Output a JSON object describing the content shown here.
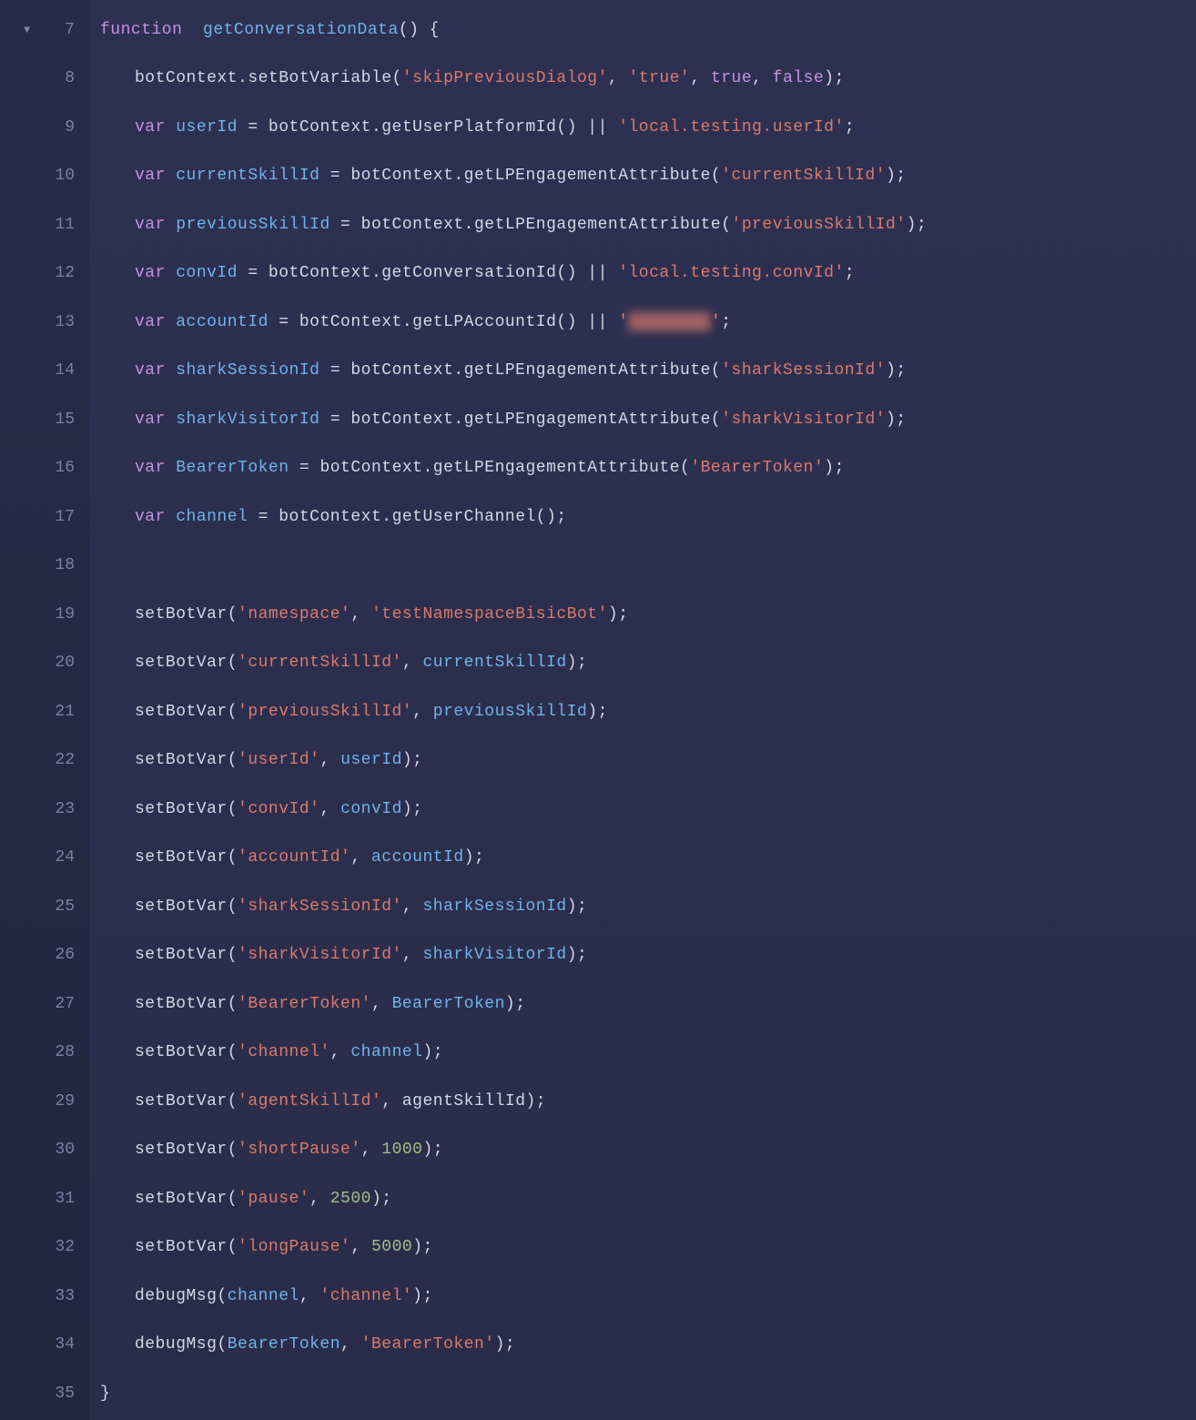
{
  "gutter": {
    "start": 7,
    "end": 35,
    "foldRow": 7
  },
  "code": {
    "lines": [
      {
        "n": 7,
        "indent": "ind1",
        "tokens": [
          [
            "kw",
            "function"
          ],
          [
            "def",
            "  "
          ],
          [
            "fn",
            "getConversationData"
          ],
          [
            "def",
            "() {"
          ]
        ]
      },
      {
        "n": 8,
        "indent": "ind2",
        "tokens": [
          [
            "def",
            "botContext.setBotVariable("
          ],
          [
            "str",
            "'skipPreviousDialog'"
          ],
          [
            "def",
            ", "
          ],
          [
            "str",
            "'true'"
          ],
          [
            "def",
            ", "
          ],
          [
            "kw",
            "true"
          ],
          [
            "def",
            ", "
          ],
          [
            "kw",
            "false"
          ],
          [
            "def",
            ");"
          ]
        ]
      },
      {
        "n": 9,
        "indent": "ind2",
        "tokens": [
          [
            "kw",
            "var"
          ],
          [
            "def",
            " "
          ],
          [
            "id",
            "userId"
          ],
          [
            "def",
            " = botContext.getUserPlatformId() || "
          ],
          [
            "str",
            "'local.testing.userId'"
          ],
          [
            "def",
            ";"
          ]
        ]
      },
      {
        "n": 10,
        "indent": "ind2",
        "tokens": [
          [
            "kw",
            "var"
          ],
          [
            "def",
            " "
          ],
          [
            "id",
            "currentSkillId"
          ],
          [
            "def",
            " = botContext.getLPEngagementAttribute("
          ],
          [
            "str",
            "'currentSkillId'"
          ],
          [
            "def",
            ");"
          ]
        ]
      },
      {
        "n": 11,
        "indent": "ind2",
        "tokens": [
          [
            "kw",
            "var"
          ],
          [
            "def",
            " "
          ],
          [
            "id",
            "previousSkillId"
          ],
          [
            "def",
            " = botContext.getLPEngagementAttribute("
          ],
          [
            "str",
            "'previousSkillId'"
          ],
          [
            "def",
            ");"
          ]
        ]
      },
      {
        "n": 12,
        "indent": "ind2",
        "tokens": [
          [
            "kw",
            "var"
          ],
          [
            "def",
            " "
          ],
          [
            "id",
            "convId"
          ],
          [
            "def",
            " = botContext.getConversationId() || "
          ],
          [
            "str",
            "'local.testing.convId'"
          ],
          [
            "def",
            ";"
          ]
        ]
      },
      {
        "n": 13,
        "indent": "ind2",
        "tokens": [
          [
            "kw",
            "var"
          ],
          [
            "def",
            " "
          ],
          [
            "id",
            "accountId"
          ],
          [
            "def",
            " = botContext.getLPAccountId() || "
          ],
          [
            "str",
            "'"
          ],
          [
            "redact",
            "████████"
          ],
          [
            "str",
            "'"
          ],
          [
            "def",
            ";"
          ]
        ]
      },
      {
        "n": 14,
        "indent": "ind2",
        "tokens": [
          [
            "kw",
            "var"
          ],
          [
            "def",
            " "
          ],
          [
            "id",
            "sharkSessionId"
          ],
          [
            "def",
            " = botContext.getLPEngagementAttribute("
          ],
          [
            "str",
            "'sharkSessionId'"
          ],
          [
            "def",
            ");"
          ]
        ]
      },
      {
        "n": 15,
        "indent": "ind2",
        "tokens": [
          [
            "kw",
            "var"
          ],
          [
            "def",
            " "
          ],
          [
            "id",
            "sharkVisitorId"
          ],
          [
            "def",
            " = botContext.getLPEngagementAttribute("
          ],
          [
            "str",
            "'sharkVisitorId'"
          ],
          [
            "def",
            ");"
          ]
        ]
      },
      {
        "n": 16,
        "indent": "ind2",
        "tokens": [
          [
            "kw",
            "var"
          ],
          [
            "def",
            " "
          ],
          [
            "id",
            "BearerToken"
          ],
          [
            "def",
            " = botContext.getLPEngagementAttribute("
          ],
          [
            "str",
            "'BearerToken'"
          ],
          [
            "def",
            ");"
          ]
        ]
      },
      {
        "n": 17,
        "indent": "ind2",
        "tokens": [
          [
            "kw",
            "var"
          ],
          [
            "def",
            " "
          ],
          [
            "id",
            "channel"
          ],
          [
            "def",
            " = botContext.getUserChannel();"
          ]
        ]
      },
      {
        "n": 18,
        "indent": "ind2",
        "tokens": [
          [
            "def",
            ""
          ]
        ]
      },
      {
        "n": 19,
        "indent": "ind2",
        "tokens": [
          [
            "def",
            "setBotVar("
          ],
          [
            "str",
            "'namespace'"
          ],
          [
            "def",
            ", "
          ],
          [
            "str",
            "'testNamespaceBisicBot'"
          ],
          [
            "def",
            ");"
          ]
        ]
      },
      {
        "n": 20,
        "indent": "ind2",
        "tokens": [
          [
            "def",
            "setBotVar("
          ],
          [
            "str",
            "'currentSkillId'"
          ],
          [
            "def",
            ", "
          ],
          [
            "id",
            "currentSkillId"
          ],
          [
            "def",
            ");"
          ]
        ]
      },
      {
        "n": 21,
        "indent": "ind2",
        "tokens": [
          [
            "def",
            "setBotVar("
          ],
          [
            "str",
            "'previousSkillId'"
          ],
          [
            "def",
            ", "
          ],
          [
            "id",
            "previousSkillId"
          ],
          [
            "def",
            ");"
          ]
        ]
      },
      {
        "n": 22,
        "indent": "ind2",
        "tokens": [
          [
            "def",
            "setBotVar("
          ],
          [
            "str",
            "'userId'"
          ],
          [
            "def",
            ", "
          ],
          [
            "id",
            "userId"
          ],
          [
            "def",
            ");"
          ]
        ]
      },
      {
        "n": 23,
        "indent": "ind2",
        "tokens": [
          [
            "def",
            "setBotVar("
          ],
          [
            "str",
            "'convId'"
          ],
          [
            "def",
            ", "
          ],
          [
            "id",
            "convId"
          ],
          [
            "def",
            ");"
          ]
        ]
      },
      {
        "n": 24,
        "indent": "ind2",
        "tokens": [
          [
            "def",
            "setBotVar("
          ],
          [
            "str",
            "'accountId'"
          ],
          [
            "def",
            ", "
          ],
          [
            "id",
            "accountId"
          ],
          [
            "def",
            ");"
          ]
        ]
      },
      {
        "n": 25,
        "indent": "ind2",
        "tokens": [
          [
            "def",
            "setBotVar("
          ],
          [
            "str",
            "'sharkSessionId'"
          ],
          [
            "def",
            ", "
          ],
          [
            "id",
            "sharkSessionId"
          ],
          [
            "def",
            ");"
          ]
        ]
      },
      {
        "n": 26,
        "indent": "ind2",
        "tokens": [
          [
            "def",
            "setBotVar("
          ],
          [
            "str",
            "'sharkVisitorId'"
          ],
          [
            "def",
            ", "
          ],
          [
            "id",
            "sharkVisitorId"
          ],
          [
            "def",
            ");"
          ]
        ]
      },
      {
        "n": 27,
        "indent": "ind2",
        "tokens": [
          [
            "def",
            "setBotVar("
          ],
          [
            "str",
            "'BearerToken'"
          ],
          [
            "def",
            ", "
          ],
          [
            "id",
            "BearerToken"
          ],
          [
            "def",
            ");"
          ]
        ]
      },
      {
        "n": 28,
        "indent": "ind2",
        "tokens": [
          [
            "def",
            "setBotVar("
          ],
          [
            "str",
            "'channel'"
          ],
          [
            "def",
            ", "
          ],
          [
            "id",
            "channel"
          ],
          [
            "def",
            ");"
          ]
        ]
      },
      {
        "n": 29,
        "indent": "ind2",
        "tokens": [
          [
            "def",
            "setBotVar("
          ],
          [
            "str",
            "'agentSkillId'"
          ],
          [
            "def",
            ", agentSkillId);"
          ]
        ]
      },
      {
        "n": 30,
        "indent": "ind2",
        "tokens": [
          [
            "def",
            "setBotVar("
          ],
          [
            "str",
            "'shortPause'"
          ],
          [
            "def",
            ", "
          ],
          [
            "num",
            "1000"
          ],
          [
            "def",
            ");"
          ]
        ]
      },
      {
        "n": 31,
        "indent": "ind2",
        "tokens": [
          [
            "def",
            "setBotVar("
          ],
          [
            "str",
            "'pause'"
          ],
          [
            "def",
            ", "
          ],
          [
            "num",
            "2500"
          ],
          [
            "def",
            ");"
          ]
        ]
      },
      {
        "n": 32,
        "indent": "ind2",
        "tokens": [
          [
            "def",
            "setBotVar("
          ],
          [
            "str",
            "'longPause'"
          ],
          [
            "def",
            ", "
          ],
          [
            "num",
            "5000"
          ],
          [
            "def",
            ");"
          ]
        ]
      },
      {
        "n": 33,
        "indent": "ind2",
        "tokens": [
          [
            "def",
            "debugMsg("
          ],
          [
            "id",
            "channel"
          ],
          [
            "def",
            ", "
          ],
          [
            "str",
            "'channel'"
          ],
          [
            "def",
            ");"
          ]
        ]
      },
      {
        "n": 34,
        "indent": "ind2",
        "tokens": [
          [
            "def",
            "debugMsg("
          ],
          [
            "id",
            "BearerToken"
          ],
          [
            "def",
            ", "
          ],
          [
            "str",
            "'BearerToken'"
          ],
          [
            "def",
            ");"
          ]
        ]
      },
      {
        "n": 35,
        "indent": "ind1",
        "tokens": [
          [
            "def",
            "}"
          ]
        ]
      }
    ]
  }
}
